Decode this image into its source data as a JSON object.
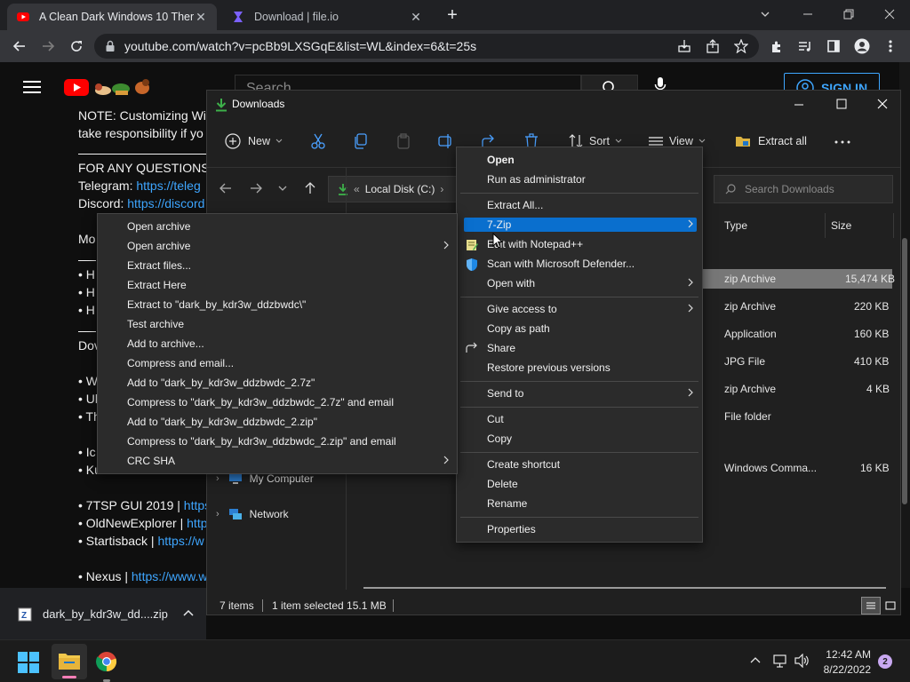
{
  "browser": {
    "tabs": [
      {
        "title": "A Clean Dark Windows 10 Theme",
        "favicon": "youtube-icon"
      },
      {
        "title": "Download | file.io",
        "favicon": "fileio-icon"
      }
    ],
    "url": "youtube.com/watch?v=pcBb9LXSGqE&list=WL&index=6&t=25s"
  },
  "youtube": {
    "search_placeholder": "Search",
    "sign_in": "SIGN IN",
    "description": {
      "line1": "NOTE: Customizing Wi",
      "line2": "take responsibility if yo",
      "questions": "FOR ANY QUESTIONS",
      "telegram_label": "Telegram:",
      "telegram_link": "https://teleg",
      "discord_label": "Discord:",
      "discord_link": "https://discord",
      "mo": "Mo",
      "bullet_h": "• H",
      "dov": "Dov",
      "bullet_w": "• W",
      "bullet_ul": "• Ul",
      "bullet_th": "• Th",
      "bullet_ic": "• Ic",
      "bullet_ku": "• Ku",
      "tsp": "• 7TSP GUI 2019 |",
      "tsp_link": "https:",
      "one": "• OldNewExplorer |",
      "one_link": "http",
      "sb": "• Startisback |",
      "sb_link": "https://w",
      "nexus": "• Nexus |",
      "nexus_link": "https://www.w"
    }
  },
  "explorer": {
    "title": "Downloads",
    "commands": {
      "new": "New",
      "sort": "Sort",
      "view": "View",
      "extract_all": "Extract all"
    },
    "path": "Local Disk (C:)",
    "search_placeholder": "Search Downloads",
    "columns": {
      "type": "Type",
      "size": "Size"
    },
    "rows": [
      {
        "type": "zip Archive",
        "size": "15,474 KB",
        "selected": true
      },
      {
        "type": "zip Archive",
        "size": "220 KB"
      },
      {
        "type": "Application",
        "size": "160 KB"
      },
      {
        "type": "JPG File",
        "size": "410 KB"
      },
      {
        "type": "zip Archive",
        "size": "4 KB"
      },
      {
        "type": "File folder",
        "size": ""
      },
      {
        "type": "Windows Comma...",
        "size": "16 KB"
      }
    ],
    "nav": {
      "my_computer": "My Computer",
      "network": "Network"
    },
    "status": {
      "items": "7 items",
      "selected": "1 item selected  15.1 MB"
    }
  },
  "zip_menu": [
    "Open archive",
    "Open archive",
    "Extract files...",
    "Extract Here",
    "Extract to \"dark_by_kdr3w_ddzbwdc\\\"",
    "Test archive",
    "Add to archive...",
    "Compress and email...",
    "Add to \"dark_by_kdr3w_ddzbwdc_2.7z\"",
    "Compress to \"dark_by_kdr3w_ddzbwdc_2.7z\" and email",
    "Add to \"dark_by_kdr3w_ddzbwdc_2.zip\"",
    "Compress to \"dark_by_kdr3w_ddzbwdc_2.zip\" and email",
    "CRC SHA"
  ],
  "context_menu": {
    "open": "Open",
    "run_admin": "Run as administrator",
    "extract_all": "Extract All...",
    "sevenzip": "7-Zip",
    "notepad": "Edit with Notepad++",
    "defender": "Scan with Microsoft Defender...",
    "open_with": "Open with",
    "give_access": "Give access to",
    "copy_path": "Copy as path",
    "share": "Share",
    "restore": "Restore previous versions",
    "send_to": "Send to",
    "cut": "Cut",
    "copy": "Copy",
    "create_shortcut": "Create shortcut",
    "delete": "Delete",
    "rename": "Rename",
    "properties": "Properties"
  },
  "download_bar": {
    "filename": "dark_by_kdr3w_dd....zip"
  },
  "taskbar": {
    "time": "12:42 AM",
    "date": "8/22/2022",
    "notifications": "2"
  },
  "colors": {
    "accent": "#0067c0",
    "link": "#3ea6ff",
    "youtube_red": "#ff0000",
    "highlight": "#0a6fce"
  }
}
